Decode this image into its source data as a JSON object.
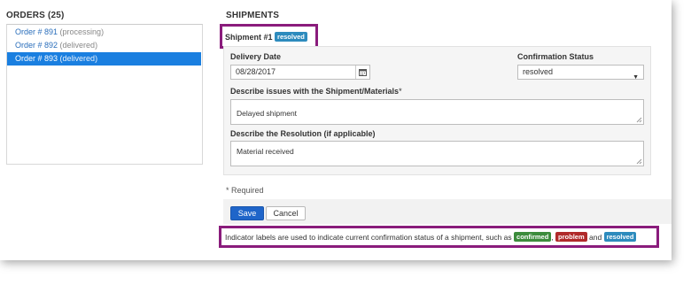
{
  "orders": {
    "title": "ORDERS (25)",
    "items": [
      {
        "label": "Order # 891",
        "status": "(processing)"
      },
      {
        "label": "Order # 892",
        "status": "(delivered)"
      },
      {
        "label": "Order # 893",
        "status": "(delivered)"
      }
    ],
    "selected_index": 2
  },
  "shipments": {
    "title": "SHIPMENTS",
    "shipment_label": "Shipment #1",
    "shipment_badge": "resolved",
    "form": {
      "delivery_date_label": "Delivery Date",
      "delivery_date_value": "08/28/2017",
      "confirmation_label": "Confirmation Status",
      "confirmation_value": "resolved",
      "issues_label": "Describe issues with the Shipment/Materials",
      "issues_required_mark": "*",
      "issues_value": "Delayed shipment",
      "resolution_label": "Describe the Resolution (if applicable)",
      "resolution_value": "Material received"
    },
    "required_note": "* Required",
    "save_label": "Save",
    "cancel_label": "Cancel"
  },
  "note": {
    "text": "Indicator labels are used to indicate current confirmation status of a shipment, such as",
    "badge_confirmed": "confirmed",
    "sep1": ",",
    "badge_problem": "problem",
    "and_word": "and",
    "badge_resolved": "resolved"
  },
  "colors": {
    "highlight": "#8a1c7c",
    "selected": "#1a7fe0",
    "link": "#2a6ebb",
    "resolved": "#2d8bbd",
    "confirmed": "#3c8c3c",
    "problem": "#b02a2a",
    "save": "#1f65c9"
  },
  "icons": {
    "date_picker": "calendar-icon",
    "select_arrow": "caret-down-icon"
  }
}
